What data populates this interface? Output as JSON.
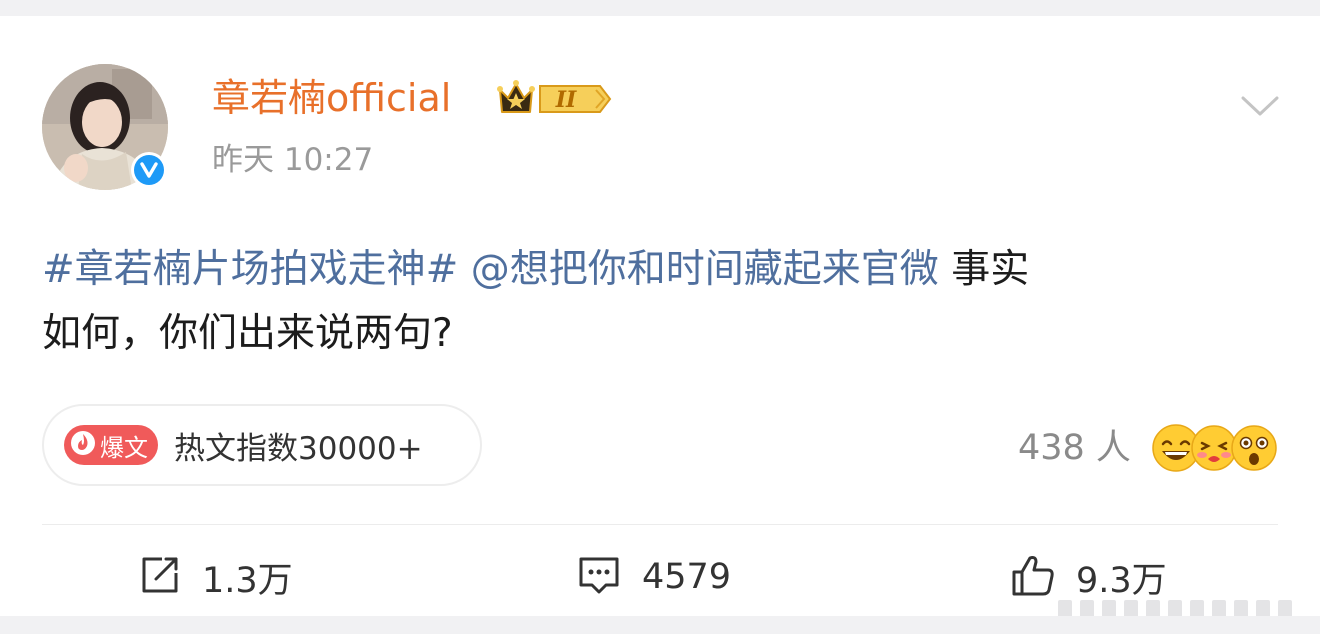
{
  "post": {
    "username": "章若楠official",
    "vip_level_mark": "II",
    "timestamp": "昨天 10:27",
    "hashtag": "#章若楠片场拍戏走神#",
    "mention": "@想把你和时间藏起来官微",
    "text_line1_tail": "事实",
    "text_line2": "如何，你们出来说两句?"
  },
  "hot": {
    "tag_label": "爆文",
    "index_label": "热文指数30000+"
  },
  "reactions": {
    "count_label": "438 人"
  },
  "actions": {
    "repost_count": "1.3万",
    "comment_count": "4579",
    "like_count": "9.3万"
  },
  "colors": {
    "username": "#e8702a",
    "link": "#4f6f9e",
    "hot_tag": "#f05a5a",
    "verified": "#1e9af7"
  },
  "icons": [
    "chevron-down-icon",
    "verified-icon",
    "vip-crown-icon",
    "flame-icon",
    "repost-icon",
    "comment-icon",
    "like-icon"
  ]
}
